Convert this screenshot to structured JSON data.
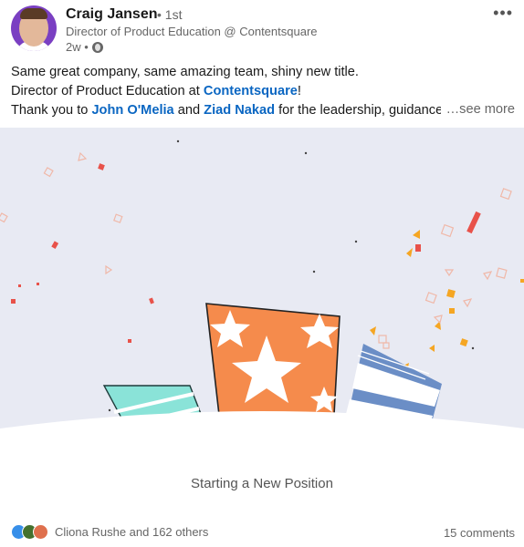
{
  "author": {
    "name": "Craig Jansen",
    "degree": "• 1st",
    "headline": "Director of Product Education @ Contentsquare",
    "time": "2w •",
    "avatar_badge": "#HIRING"
  },
  "post": {
    "line1": "Same great company, same amazing team, shiny new title.",
    "line2_prefix": "Director of Product Education at ",
    "line2_link": "Contentsquare",
    "line2_suffix": "!",
    "line3_prefix": "Thank you to ",
    "line3_link1": "John O'Melia",
    "line3_mid": " and ",
    "line3_link2": "Ziad Nakad",
    "line3_suffix": " for the leadership, guidance",
    "see_more": "…see more"
  },
  "banner": {
    "caption": "Starting a New Position"
  },
  "social": {
    "reactions_text": "Cliona Rushe and 162 others",
    "comments_text": "15 comments"
  },
  "colors": {
    "link": "#0a66c2",
    "banner_bg": "#e8eaf3",
    "orange": "#f58b4c",
    "teal": "#8ae3d8",
    "blue": "#6b8ec6"
  }
}
